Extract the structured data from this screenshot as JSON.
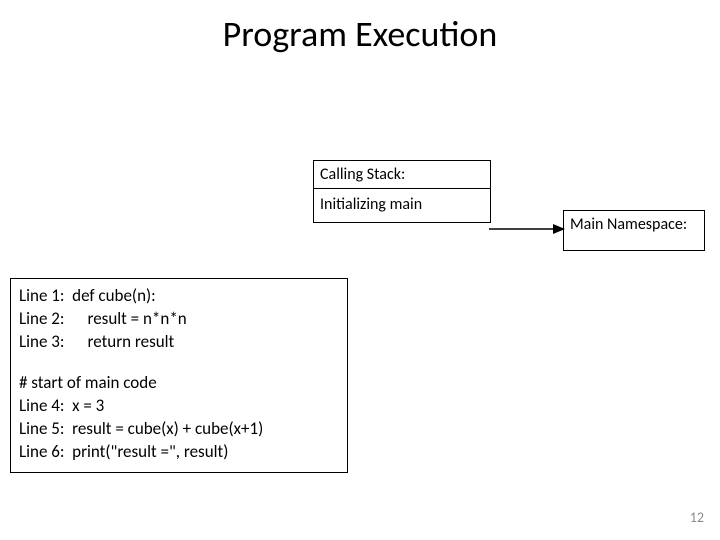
{
  "title": "Program Execution",
  "stack": {
    "header": "Calling Stack:",
    "state": "Initializing main"
  },
  "namespace": {
    "header": "Main Namespace:"
  },
  "code": {
    "line1": "Line 1:  def cube(n):",
    "line2": "Line 2:      result = n*n*n",
    "line3": "Line 3:      return result",
    "comment": "# start of main code",
    "line4": "Line 4:  x = 3",
    "line5": "Line 5:  result = cube(x) + cube(x+1)",
    "line6": "Line 6:  print(\"result =\", result)"
  },
  "page_number": "12"
}
